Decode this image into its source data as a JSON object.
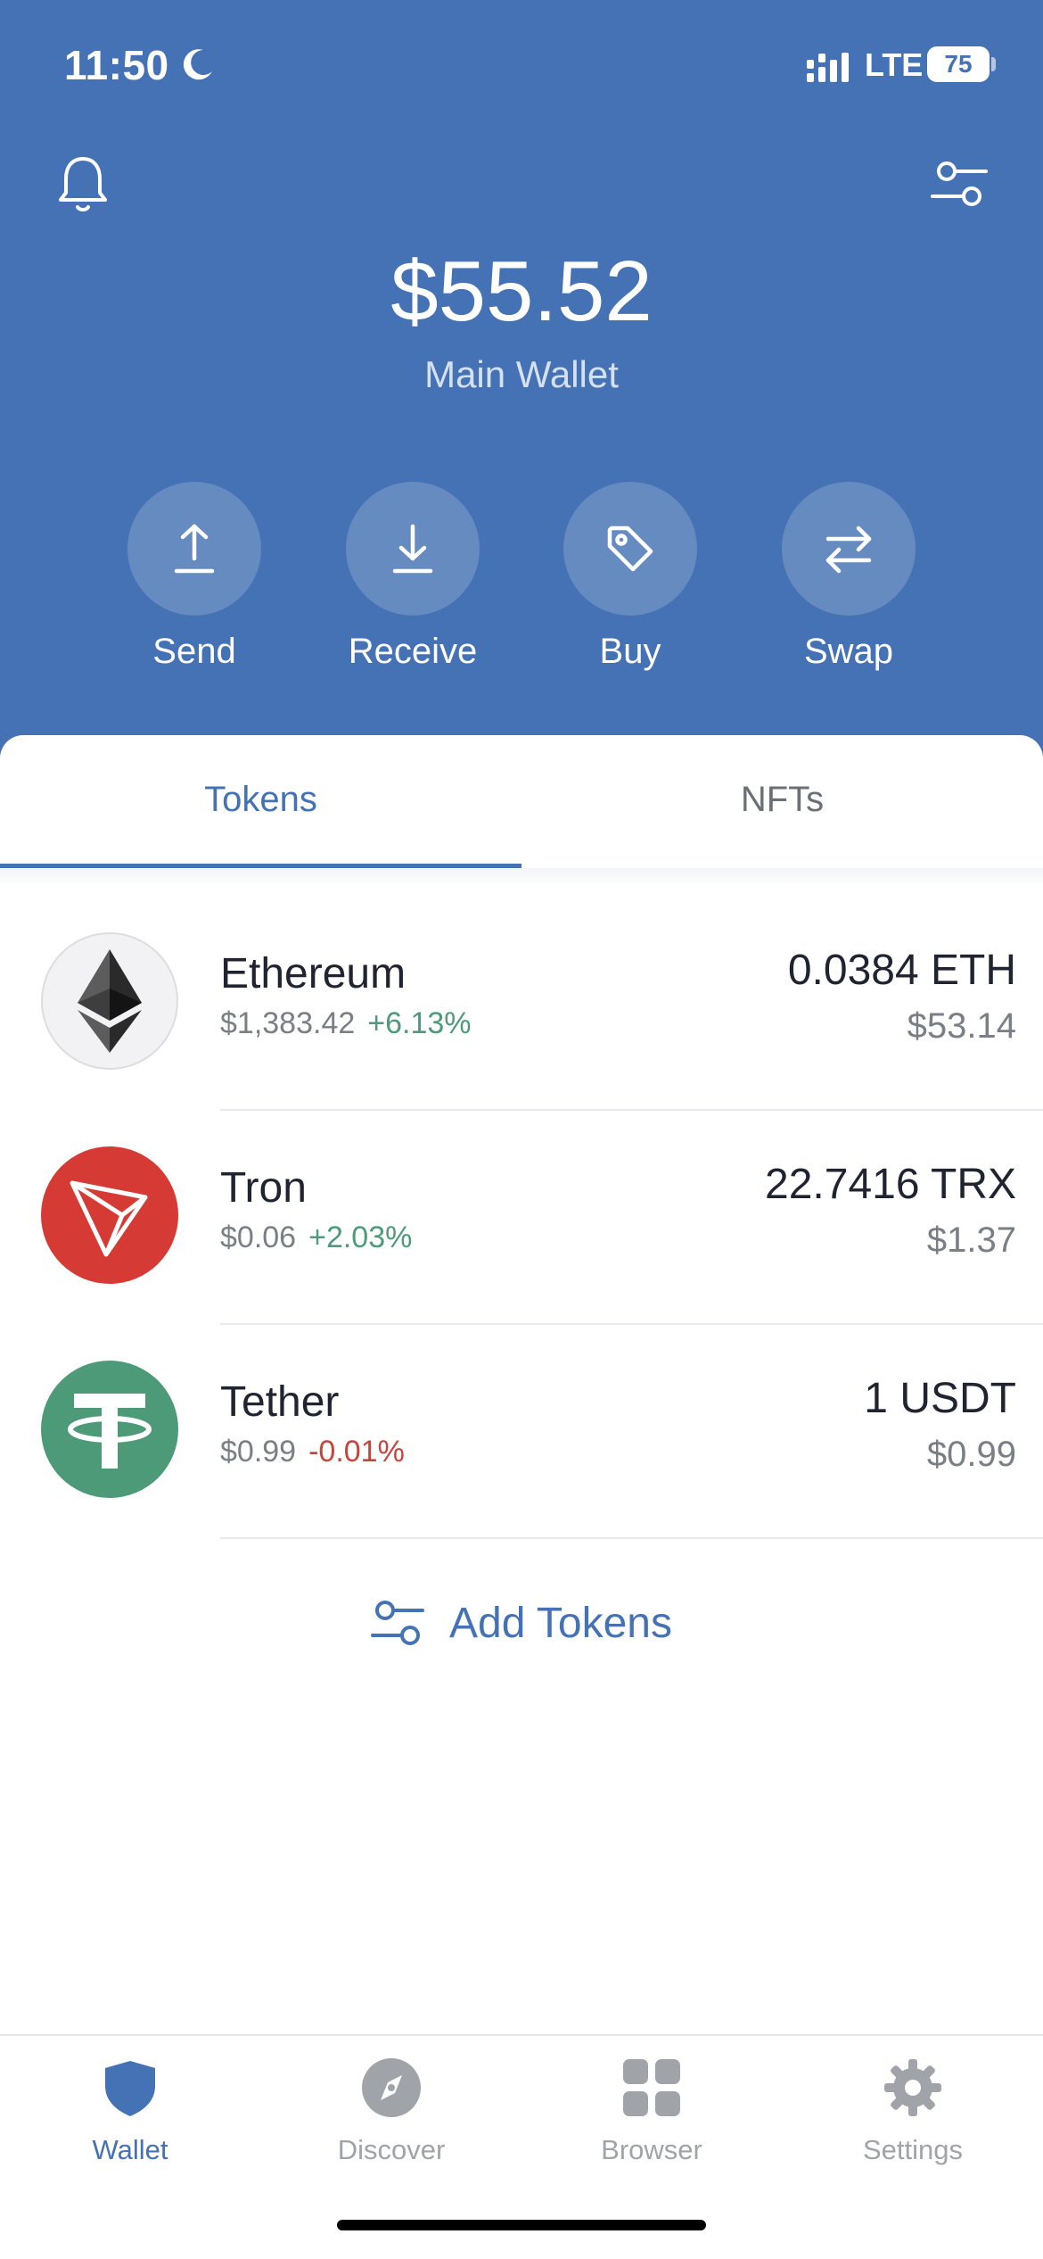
{
  "status_bar": {
    "time": "11:50",
    "network": "LTE",
    "battery": "75"
  },
  "header": {
    "balance": "$55.52",
    "wallet_name": "Main Wallet"
  },
  "actions": [
    {
      "label": "Send",
      "icon": "upload-arrow-icon"
    },
    {
      "label": "Receive",
      "icon": "download-arrow-icon"
    },
    {
      "label": "Buy",
      "icon": "tag-icon"
    },
    {
      "label": "Swap",
      "icon": "swap-arrows-icon"
    }
  ],
  "tabs": [
    {
      "label": "Tokens",
      "active": true
    },
    {
      "label": "NFTs",
      "active": false
    }
  ],
  "tokens": [
    {
      "name": "Ethereum",
      "price": "$1,383.42",
      "change": "+6.13%",
      "amount": "0.0384 ETH",
      "value": "$53.14",
      "icon": "ethereum-icon"
    },
    {
      "name": "Tron",
      "price": "$0.06",
      "change": "+2.03%",
      "amount": "22.7416 TRX",
      "value": "$1.37",
      "icon": "tron-icon"
    },
    {
      "name": "Tether",
      "price": "$0.99",
      "change": "-0.01%",
      "amount": "1 USDT",
      "value": "$0.99",
      "icon": "tether-icon"
    }
  ],
  "add_tokens_label": "Add Tokens",
  "bottom_nav": [
    {
      "label": "Wallet",
      "icon": "shield-icon",
      "active": true
    },
    {
      "label": "Discover",
      "icon": "compass-icon",
      "active": false
    },
    {
      "label": "Browser",
      "icon": "grid-icon",
      "active": false
    },
    {
      "label": "Settings",
      "icon": "gear-icon",
      "active": false
    }
  ],
  "colors": {
    "brand": "#4472b4",
    "positive": "#4e9a7c",
    "negative": "#c5453d"
  }
}
